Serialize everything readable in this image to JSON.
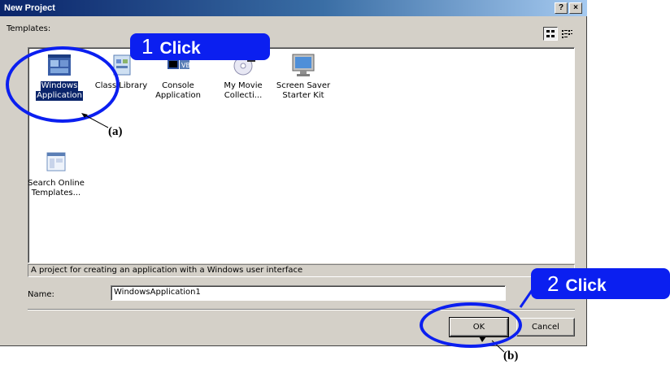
{
  "window": {
    "title": "New Project",
    "help_button": "?",
    "close_button": "×"
  },
  "templates": {
    "label": "Templates:",
    "view_large_icon": "large-icons-view-icon",
    "view_small_icon": "small-icons-view-icon",
    "items": [
      {
        "label_line1": "Windows",
        "label_line2": "Application",
        "icon": "windows-application-icon",
        "selected": true
      },
      {
        "label_line1": "Class Library",
        "label_line2": "",
        "icon": "class-library-icon",
        "selected": false
      },
      {
        "label_line1": "Console",
        "label_line2": "Application",
        "icon": "console-application-icon",
        "selected": false
      },
      {
        "label_line1": "My Movie",
        "label_line2": "Collecti...",
        "icon": "my-movie-collection-icon",
        "selected": false
      },
      {
        "label_line1": "Screen Saver",
        "label_line2": "Starter Kit",
        "icon": "screen-saver-icon",
        "selected": false
      },
      {
        "label_line1": "Search Online",
        "label_line2": "Templates...",
        "icon": "search-online-templates-icon",
        "selected": false
      }
    ]
  },
  "description": "A project for creating an application with a Windows user interface",
  "name_field": {
    "label": "Name:",
    "value": "WindowsApplication1"
  },
  "buttons": {
    "ok": "OK",
    "cancel": "Cancel"
  },
  "annotations": {
    "step1_number": "1",
    "step1_word": "Click",
    "step2_number": "2",
    "step2_word": "Click",
    "marker_a": "(a)",
    "marker_b": "(b)"
  },
  "colors": {
    "annotation_blue": "#0b1ff0",
    "titlebar_start": "#0a246a",
    "selection": "#0a246a",
    "dialog_face": "#d4d0c8"
  }
}
